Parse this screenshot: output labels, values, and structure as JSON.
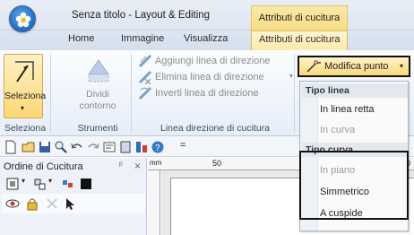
{
  "window": {
    "title": "Senza titolo - Layout & Editing",
    "context_tab_header": "Attributi di cucitura"
  },
  "tabs": [
    {
      "label": "Home",
      "active": false
    },
    {
      "label": "Immagine",
      "active": false
    },
    {
      "label": "Visualizza",
      "active": false
    },
    {
      "label": "Attributi di cucitura",
      "active": true
    }
  ],
  "ribbon": {
    "seleziona": {
      "label": "Seleziona",
      "group": "Seleziona"
    },
    "strumenti": {
      "label_line1": "Dividi",
      "label_line2": "contorno",
      "group": "Strumenti"
    },
    "linea_direzione": {
      "group": "Linea direzione di cucitura",
      "items": [
        {
          "label": "Aggiungi linea di direzione",
          "icon": "add-direction-line-icon"
        },
        {
          "label": "Elimina linea di direzione",
          "icon": "delete-direction-line-icon",
          "has_dropdown": true
        },
        {
          "label": "Inverti linea di direzione",
          "icon": "invert-direction-line-icon"
        }
      ]
    },
    "modifica_punto": {
      "label": "Modifica punto",
      "icon": "edit-point-icon"
    }
  },
  "menu": {
    "sections": [
      {
        "header": "Tipo linea",
        "items": [
          {
            "label": "In linea retta",
            "enabled": true
          },
          {
            "label": "In curva",
            "enabled": false
          }
        ]
      },
      {
        "header": "Tipo curva",
        "items": [
          {
            "label": "In piano",
            "enabled": false
          },
          {
            "label": "Simmetrico",
            "enabled": true
          },
          {
            "label": "A cuspide",
            "enabled": true
          }
        ]
      }
    ]
  },
  "pane": {
    "title": "Ordine di Cucitura",
    "pin_glyph": "ᵖ",
    "close_glyph": "×"
  },
  "ruler": {
    "unit": "mm",
    "tick_50": "50",
    "tick_cut": "0"
  },
  "qat_dropdown_glyph": "=",
  "colors": {
    "accent_selected": "#fbd877",
    "context_tab": "#f7dc86",
    "ribbon_bg": "#e7eef8",
    "highlight_border": "#111111"
  }
}
